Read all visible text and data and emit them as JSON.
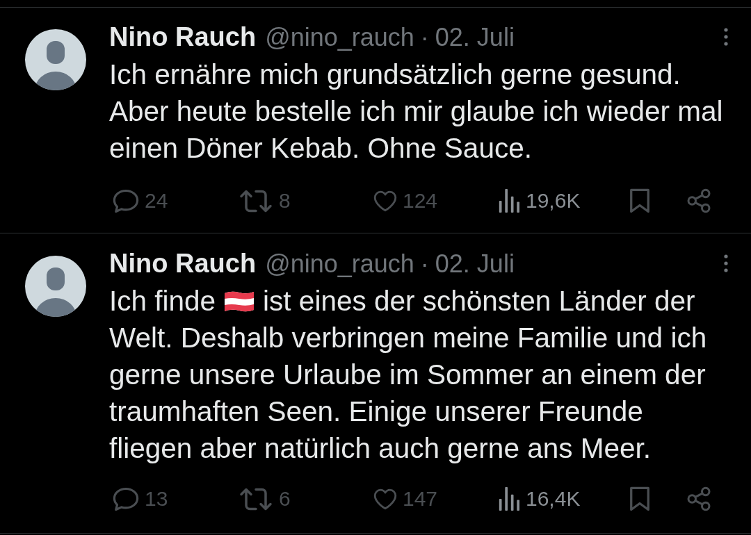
{
  "tweets": [
    {
      "author": "Nino Rauch",
      "handle": "@nino_rauch",
      "separator": "·",
      "date": "02. Juli",
      "body": [
        {
          "kind": "text",
          "text": "Ich ernähre mich grundsätzlich gerne gesund. Aber heute bestelle ich mir glaube ich wieder mal einen Döner Kebab. Ohne Sauce."
        }
      ],
      "actions": [
        {
          "kind": "reply",
          "count": "24"
        },
        {
          "kind": "repost",
          "count": "8"
        },
        {
          "kind": "like",
          "count": "124"
        },
        {
          "kind": "views",
          "count": "19,6K"
        },
        {
          "kind": "bookmark"
        },
        {
          "kind": "share"
        }
      ]
    },
    {
      "author": "Nino Rauch",
      "handle": "@nino_rauch",
      "separator": "·",
      "date": "02. Juli",
      "body": [
        {
          "kind": "text",
          "text": "Ich finde"
        },
        {
          "kind": "flag"
        },
        {
          "kind": "text",
          "text": "ist eines der schönsten Länder der Welt. Deshalb verbringen meine Familie und ich gerne unsere Urlaube im Sommer an einem der traumhaften Seen. Einige unserer Freunde\nfliegen aber natürlich auch gerne ans Meer."
        }
      ],
      "actions": [
        {
          "kind": "reply",
          "count": "13"
        },
        {
          "kind": "repost",
          "count": "6"
        },
        {
          "kind": "like",
          "count": "147"
        },
        {
          "kind": "views",
          "count": "16,4K"
        },
        {
          "kind": "bookmark"
        },
        {
          "kind": "share"
        }
      ]
    }
  ]
}
